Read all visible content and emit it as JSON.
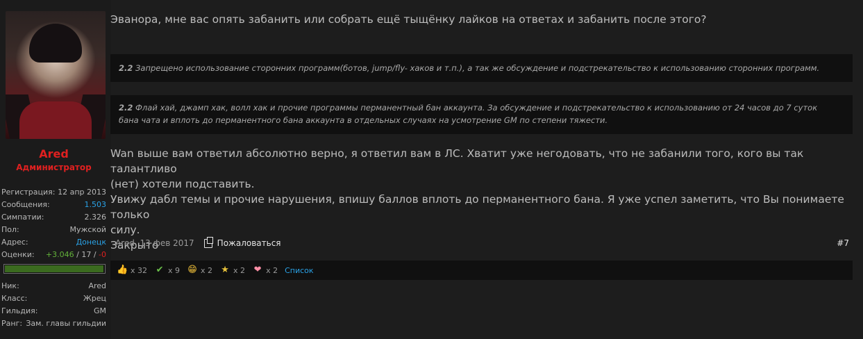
{
  "user": {
    "name": "Ared",
    "title": "Администратор",
    "stats": [
      {
        "label": "Регистрация:",
        "value": "12 апр 2013"
      },
      {
        "label": "Сообщения:",
        "value": "1.503"
      },
      {
        "label": "Симпатии:",
        "value": "2.326"
      },
      {
        "label": "Пол:",
        "value": "Мужской"
      },
      {
        "label": "Адрес:",
        "value": "Донецк"
      }
    ],
    "rating": {
      "label": "Оценки:",
      "positive": "+3.046",
      "sep1": " / ",
      "neutral": "17",
      "sep2": " / ",
      "negative": "-0",
      "bar_fraction": 0.99
    },
    "extra": [
      {
        "label": "Ник:",
        "value": "Ared"
      },
      {
        "label": "Класс:",
        "value": "Жрец"
      },
      {
        "label": "Гильдия:",
        "value": "GM"
      },
      {
        "label": "Ранг:",
        "value": "Зам. главы гильдии"
      }
    ]
  },
  "post": {
    "intro": "Эванора, мне вас опять забанить или собрать ещё тыщёнку лайков на ответах и забанить после этого?",
    "quote1": {
      "num": "2.2",
      "text": " Запрещено использование сторонних программ(ботов, jump/fly- хаков и т.п.), а так же обсуждение и подстрекательство к использованию сторонних программ."
    },
    "quote2": {
      "num": "2.2",
      "line1": " Флай хай, джамп хак, волл хак и прочие программы перманентный бан аккаунта. За обсуждение и подстрекательство к использованию от 24 часов до 7 суток",
      "line2": "бана чата и вплоть до перманентного бана аккаунта в отдельных случаях на усмотрение GM по степени тяжести."
    },
    "body": [
      "Wan выше вам ответил абсолютно верно, я ответил вам в ЛС. Хватит уже негодовать, что не забанили того, кого вы так талантливо",
      "(нет) хотели подставить.",
      "Увижу дабл темы и прочие нарушения, впишу баллов вплоть до перманентного бана. Я уже успел заметить, что Вы понимаете только",
      "силу.",
      "Закрыто"
    ],
    "meta": "Ared, 13 фев 2017",
    "report_label": "Пожаловаться",
    "number": "#7"
  },
  "likes": [
    {
      "icon": "thumbs-up-icon",
      "count": "x 32"
    },
    {
      "icon": "check-icon",
      "count": "x 9"
    },
    {
      "icon": "smile-icon",
      "count": "x 2"
    },
    {
      "icon": "star-medal-icon",
      "count": "x 2"
    },
    {
      "icon": "heart-icon",
      "count": "x 2"
    }
  ],
  "likes_list_label": "Список"
}
